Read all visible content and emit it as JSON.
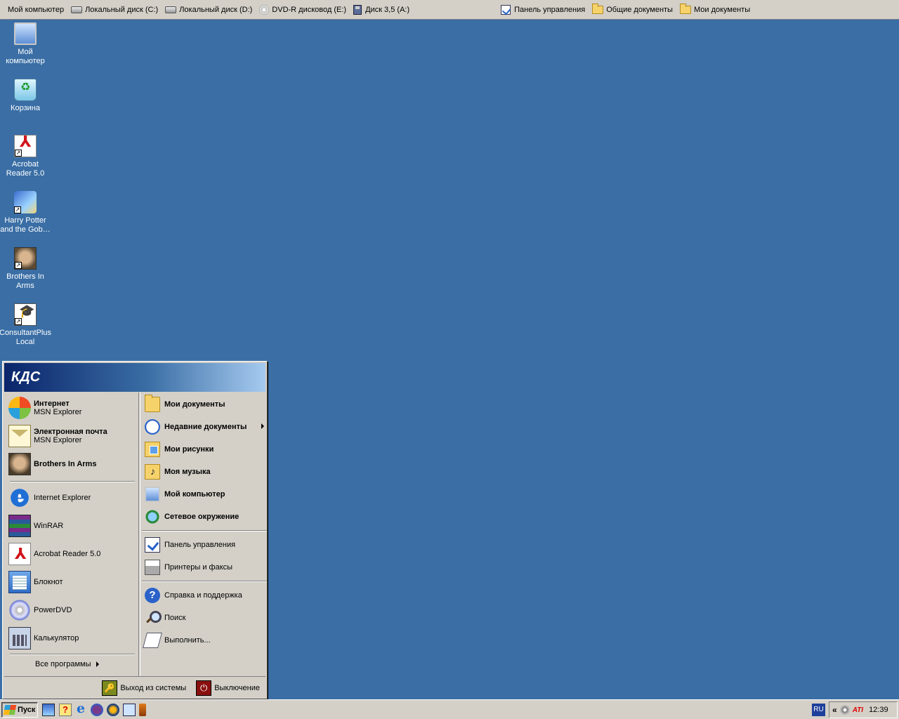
{
  "topbar": {
    "items": [
      {
        "label": "Мой компьютер",
        "icon": "none"
      },
      {
        "label": "Локальный диск (C:)",
        "icon": "drive-icon"
      },
      {
        "label": "Локальный диск (D:)",
        "icon": "drive-icon"
      },
      {
        "label": "DVD-R дисковод (E:)",
        "icon": "dvd-icon"
      },
      {
        "label": "Диск 3,5 (A:)",
        "icon": "floppy-icon"
      },
      {
        "label": "Панель управления",
        "icon": "control-panel-icon"
      },
      {
        "label": "Общие документы",
        "icon": "folder-icon"
      },
      {
        "label": "Мои документы",
        "icon": "folder-icon"
      }
    ]
  },
  "desktop": {
    "icons": [
      {
        "label": "Мой компьютер",
        "icon": "my-computer-icon"
      },
      {
        "label": "Корзина",
        "icon": "recycle-bin-icon"
      },
      {
        "label": "Acrobat Reader 5.0",
        "icon": "acrobat-icon"
      },
      {
        "label": "Harry Potter and the Gob…",
        "icon": "harry-potter-icon"
      },
      {
        "label": "Brothers In Arms",
        "icon": "brothers-in-arms-icon"
      },
      {
        "label": "ConsultantPlus Local",
        "icon": "consultantplus-icon"
      }
    ]
  },
  "start_menu": {
    "user": "КДС",
    "pinned": [
      {
        "title": "Интернет",
        "sub": "MSN Explorer",
        "icon": "msn-icon"
      },
      {
        "title": "Электронная почта",
        "sub": "MSN Explorer",
        "icon": "mail-icon"
      },
      {
        "title": "Brothers In Arms",
        "sub": "",
        "icon": "brothers-in-arms-icon"
      }
    ],
    "recent": [
      {
        "title": "Internet Explorer",
        "icon": "internet-explorer-icon"
      },
      {
        "title": "WinRAR",
        "icon": "winrar-icon"
      },
      {
        "title": "Acrobat Reader 5.0",
        "icon": "acrobat-icon"
      },
      {
        "title": "Блокнот",
        "icon": "notepad-icon"
      },
      {
        "title": "PowerDVD",
        "icon": "powerdvd-icon"
      },
      {
        "title": "Калькулятор",
        "icon": "calculator-icon"
      }
    ],
    "all_programs": "Все программы",
    "right": {
      "places": [
        {
          "label": "Мои документы",
          "icon": "my-documents-icon"
        },
        {
          "label": "Недавние документы",
          "icon": "recent-documents-icon"
        },
        {
          "label": "Мои рисунки",
          "icon": "my-pictures-icon"
        },
        {
          "label": "Моя музыка",
          "icon": "my-music-icon"
        },
        {
          "label": "Мой компьютер",
          "icon": "my-computer-icon"
        },
        {
          "label": "Сетевое окружение",
          "icon": "network-icon"
        }
      ],
      "settings": [
        {
          "label": "Панель управления",
          "icon": "control-panel-icon"
        },
        {
          "label": "Принтеры и факсы",
          "icon": "printer-icon"
        }
      ],
      "tools": [
        {
          "label": "Справка и поддержка",
          "icon": "help-icon"
        },
        {
          "label": "Поиск",
          "icon": "search-icon"
        },
        {
          "label": "Выполнить...",
          "icon": "run-icon"
        }
      ]
    },
    "logoff": "Выход из системы",
    "shutdown": "Выключение"
  },
  "taskbar": {
    "start_label": "Пуск",
    "language": "RU",
    "clock": "12:39",
    "tray_chevron": "«",
    "tray_brand": "ATI"
  }
}
